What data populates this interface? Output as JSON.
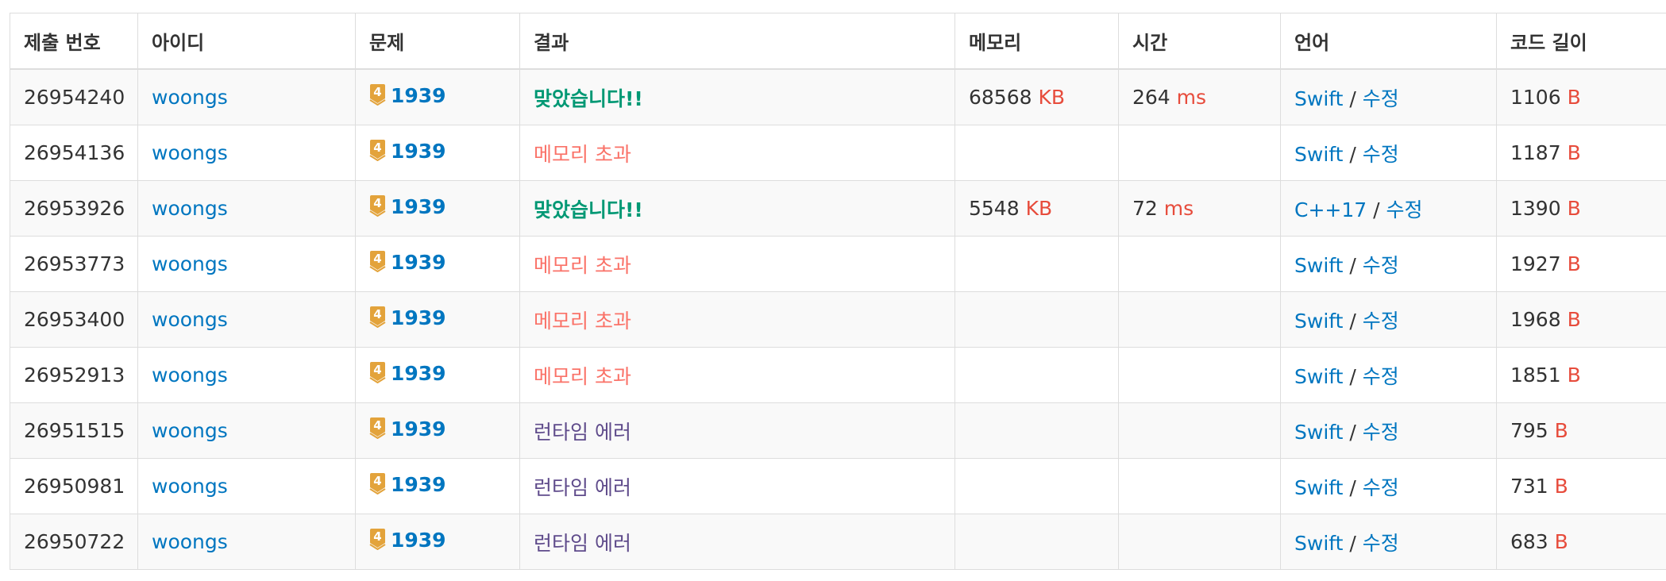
{
  "columns": [
    "제출 번호",
    "아이디",
    "문제",
    "결과",
    "메모리",
    "시간",
    "언어",
    "코드 길이"
  ],
  "units": {
    "memory": "KB",
    "time": "ms",
    "length": "B"
  },
  "colors": {
    "accepted": "#009874",
    "memory_exceeded": "#fa7268",
    "runtime_error": "#5f4b8b",
    "link": "#0076c0",
    "unit": "#e74c3c",
    "tier_badge": "#e3a33b"
  },
  "rows": [
    {
      "id": "26954240",
      "user": "woongs",
      "tier_icon": "gold-4-tier-icon",
      "tier": "4",
      "problem": "1939",
      "result": "맞았습니다!!",
      "result_type": "accepted",
      "memory": "68568",
      "time": "264",
      "language": "Swift",
      "edit": "수정",
      "length": "1106"
    },
    {
      "id": "26954136",
      "user": "woongs",
      "tier_icon": "gold-4-tier-icon",
      "tier": "4",
      "problem": "1939",
      "result": "메모리 초과",
      "result_type": "memory_exceeded",
      "memory": "",
      "time": "",
      "language": "Swift",
      "edit": "수정",
      "length": "1187"
    },
    {
      "id": "26953926",
      "user": "woongs",
      "tier_icon": "gold-4-tier-icon",
      "tier": "4",
      "problem": "1939",
      "result": "맞았습니다!!",
      "result_type": "accepted",
      "memory": "5548",
      "time": "72",
      "language": "C++17",
      "edit": "수정",
      "length": "1390"
    },
    {
      "id": "26953773",
      "user": "woongs",
      "tier_icon": "gold-4-tier-icon",
      "tier": "4",
      "problem": "1939",
      "result": "메모리 초과",
      "result_type": "memory_exceeded",
      "memory": "",
      "time": "",
      "language": "Swift",
      "edit": "수정",
      "length": "1927"
    },
    {
      "id": "26953400",
      "user": "woongs",
      "tier_icon": "gold-4-tier-icon",
      "tier": "4",
      "problem": "1939",
      "result": "메모리 초과",
      "result_type": "memory_exceeded",
      "memory": "",
      "time": "",
      "language": "Swift",
      "edit": "수정",
      "length": "1968"
    },
    {
      "id": "26952913",
      "user": "woongs",
      "tier_icon": "gold-4-tier-icon",
      "tier": "4",
      "problem": "1939",
      "result": "메모리 초과",
      "result_type": "memory_exceeded",
      "memory": "",
      "time": "",
      "language": "Swift",
      "edit": "수정",
      "length": "1851"
    },
    {
      "id": "26951515",
      "user": "woongs",
      "tier_icon": "gold-4-tier-icon",
      "tier": "4",
      "problem": "1939",
      "result": "런타임 에러",
      "result_type": "runtime_error",
      "memory": "",
      "time": "",
      "language": "Swift",
      "edit": "수정",
      "length": "795"
    },
    {
      "id": "26950981",
      "user": "woongs",
      "tier_icon": "gold-4-tier-icon",
      "tier": "4",
      "problem": "1939",
      "result": "런타임 에러",
      "result_type": "runtime_error",
      "memory": "",
      "time": "",
      "language": "Swift",
      "edit": "수정",
      "length": "731"
    },
    {
      "id": "26950722",
      "user": "woongs",
      "tier_icon": "gold-4-tier-icon",
      "tier": "4",
      "problem": "1939",
      "result": "런타임 에러",
      "result_type": "runtime_error",
      "memory": "",
      "time": "",
      "language": "Swift",
      "edit": "수정",
      "length": "683"
    }
  ]
}
